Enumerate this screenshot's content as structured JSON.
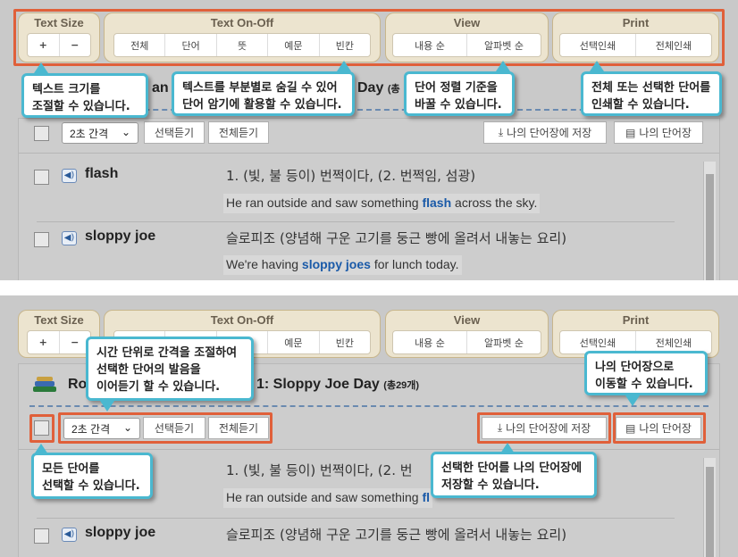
{
  "toolbar": {
    "text_size": {
      "title": "Text Size",
      "plus": "+",
      "minus": "−"
    },
    "text_onoff": {
      "title": "Text On-Off",
      "buttons": [
        "전체",
        "단어",
        "뜻",
        "예문",
        "빈칸"
      ]
    },
    "view": {
      "title": "View",
      "buttons": [
        "내용 순",
        "알파벳 순"
      ]
    },
    "print": {
      "title": "Print",
      "buttons": [
        "선택인쇄",
        "전체인쇄"
      ]
    }
  },
  "top_callouts": {
    "text_size": "텍스트 크기를\n조절할 수 있습니다.",
    "text_onoff": "텍스트를 부분별로 숨길 수 있어\n단어 암기에 활용할 수 있습니다.",
    "view": "단어 정렬 기준을\n바꿀 수 있습니다.",
    "print": "전체 또는 선택한 단어를\n인쇄할 수 있습니다."
  },
  "lesson": {
    "title_prefix": "Ro",
    "title_fragment_top": "an",
    "title_day_top": "Day",
    "title_count_top": "(총",
    "title_suffix": "1: Sloppy Joe Day",
    "count": "(총29개)"
  },
  "controls": {
    "interval_select": "2초 간격",
    "listen_selected": "선택듣기",
    "listen_all": "전체듣기",
    "save_to_notebook": "나의 단어장에 저장",
    "my_notebook": "나의 단어장"
  },
  "entries": [
    {
      "word": "flash",
      "meaning": "1. (빛, 불 등이) 번쩍이다, (2. 번쩍임, 섬광)",
      "meaning_short": "1. (빛, 불 등이) 번쩍이다, (2. 번",
      "example_before": "He ran outside and saw something ",
      "example_highlight": "flash",
      "example_after": " across the sky.",
      "example_partial_highlight": "fl"
    },
    {
      "word": "sloppy joe",
      "meaning": "슬로피조 (양념해 구운 고기를 둥근 빵에 올려서 내놓는 요리)",
      "example_before": "We're having ",
      "example_highlight": "sloppy joes",
      "example_after": " for lunch today."
    }
  ],
  "bottom_callouts": {
    "interval": "시간 단위로 간격을 조절하여\n선택한 단어의 발음을\n이어듣기 할 수 있습니다.",
    "notebook": "나의 단어장으로\n이동할 수 있습니다.",
    "select_all": "모든 단어를\n선택할 수 있습니다.",
    "save": "선택한 단어를 나의 단어장에\n저장할 수 있습니다."
  },
  "colors": {
    "highlight_frame": "#e0603a",
    "callout_border": "#4ab8d0",
    "keyword": "#1a5aa8"
  }
}
